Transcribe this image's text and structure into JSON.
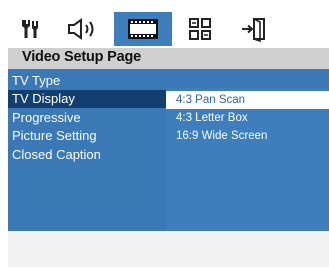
{
  "tabs": [
    {
      "icon": "general-setup-icon",
      "active": false
    },
    {
      "icon": "audio-setup-icon",
      "active": false
    },
    {
      "icon": "video-setup-icon",
      "active": true
    },
    {
      "icon": "preference-setup-icon",
      "active": false
    },
    {
      "icon": "exit-setup-icon",
      "active": false
    }
  ],
  "page_title": "Video Setup Page",
  "menu": {
    "items": [
      {
        "label": "TV Type"
      },
      {
        "label": "TV Display"
      },
      {
        "label": "Progressive"
      },
      {
        "label": "Picture Setting"
      },
      {
        "label": "Closed Caption"
      }
    ],
    "selected_index": 1
  },
  "options": {
    "items": [
      {
        "label": "4:3 Pan Scan"
      },
      {
        "label": "4:3 Letter Box"
      },
      {
        "label": "16:9 Wide Screen"
      }
    ],
    "selected_index": 0
  },
  "status_text": "",
  "colors": {
    "menu_bg": "#3a78b6",
    "options_bg": "#3e7ebd",
    "menu_selected": "#123f6d",
    "option_selected_text": "#2f6aa8",
    "title_bar": "#cfcfcf",
    "status_bar": "#f2f2f2"
  }
}
